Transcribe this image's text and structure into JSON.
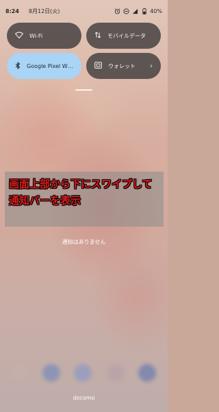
{
  "status_bar": {
    "time": "8:24",
    "date": "8月12日(火)",
    "battery": "40%",
    "icons": [
      "alarm-icon",
      "do-not-disturb-icon",
      "mobile-signal-icon",
      "battery-icon"
    ]
  },
  "quick_settings": [
    {
      "label": "Wi-Fi",
      "icon": "wifi-icon",
      "state": "off"
    },
    {
      "label": "モバイルデータ",
      "icon": "mobile-data-icon",
      "state": "off"
    },
    {
      "label": "Google Pixel W…",
      "icon": "bluetooth-icon",
      "state": "on"
    },
    {
      "label": "ウォレット",
      "icon": "wallet-icon",
      "state": "off",
      "chevron": "›"
    }
  ],
  "annotation": {
    "line1": "画面上部から下にスワイプして",
    "line2": "通知バーを表示",
    "color": "#e01d1d"
  },
  "notifications": {
    "empty_text": "通知はありません"
  },
  "carrier": "docomo",
  "colors": {
    "tile_off": "#484444",
    "tile_on": "#a9d4f6"
  }
}
